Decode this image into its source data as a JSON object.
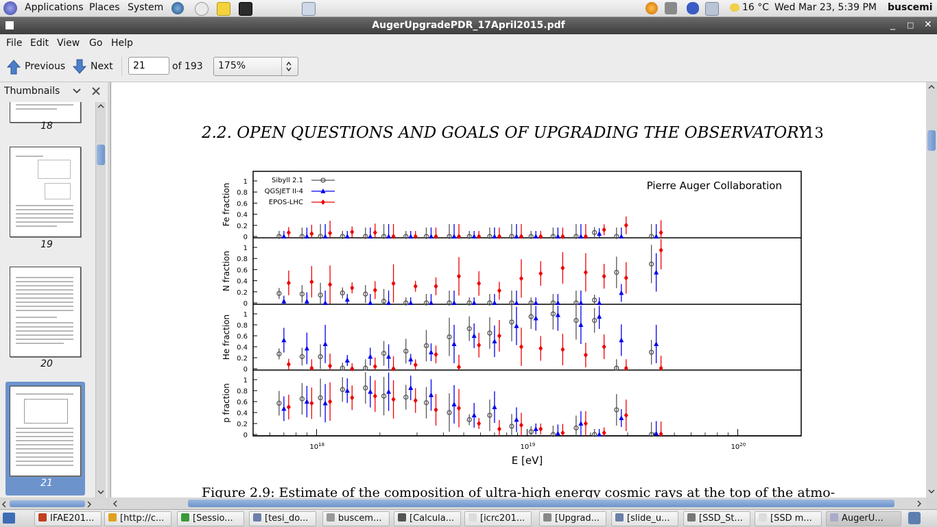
{
  "top_panel": {
    "menus": [
      "Applications",
      "Places",
      "System"
    ],
    "weather": "16 °C",
    "clock": "Wed Mar 23,  5:39 PM",
    "user": "buscemi"
  },
  "window": {
    "title": "AugerUpgradePDR_17April2015.pdf",
    "controls": {
      "minimize": "_",
      "maximize": "□",
      "close": "✕"
    }
  },
  "menubar": [
    "File",
    "Edit",
    "View",
    "Go",
    "Help"
  ],
  "toolbar": {
    "previous_label": "Previous",
    "next_label": "Next",
    "page_value": "21",
    "page_total": "of 193",
    "zoom": "175%"
  },
  "sidebar": {
    "title": "Thumbnails",
    "thumbnails": [
      {
        "label": "18"
      },
      {
        "label": "19"
      },
      {
        "label": "20"
      },
      {
        "label": "21",
        "selected": true
      }
    ]
  },
  "document": {
    "header": "2.2.  OPEN QUESTIONS AND GOALS OF UPGRADING THE OBSERVATORY",
    "page_number": "13",
    "caption": "Figure 2.9:  Estimate of the composition of ultra-high energy cosmic rays at the top of the atmo-"
  },
  "chart_data": {
    "type": "scatter",
    "annotation": "Pierre Auger Collaboration",
    "xlabel": "E [eV]",
    "xscale": "log",
    "xlim": [
      5e+17,
      2e+20
    ],
    "xticks": [
      "10^18",
      "10^19",
      "10^20"
    ],
    "legend": [
      "Sibyll 2.1",
      "QGSJET II-4",
      "EPOS-LHC"
    ],
    "legend_position": "top-left",
    "colors": {
      "Sibyll 2.1": "#555555",
      "QGSJET II-4": "#0000ee",
      "EPOS-LHC": "#ee0000"
    },
    "panels": [
      {
        "ylabel": "Fe fraction",
        "ylim": [
          0,
          1
        ],
        "yticks": [
          "0",
          "0.2",
          "0.4",
          "0.6",
          "0.8",
          "1"
        ],
        "x": [
          7e+17,
          9e+17,
          1.1e+18,
          1.4e+18,
          1.8e+18,
          2.2e+18,
          2.8e+18,
          3.5e+18,
          4.5e+18,
          5.6e+18,
          7e+18,
          8.9e+18,
          1.1e+19,
          1.4e+19,
          1.8e+19,
          2.2e+19,
          2.8e+19,
          4.1e+19
        ],
        "series": [
          {
            "name": "Sibyll 2.1",
            "values": [
              0,
              0,
              0,
              0,
              0,
              0,
              0,
              0,
              0,
              0,
              0,
              0,
              0,
              0,
              0,
              0.07,
              0,
              0
            ]
          },
          {
            "name": "QGSJET II-4",
            "values": [
              0,
              0,
              0,
              0,
              0,
              0,
              0,
              0,
              0,
              0,
              0,
              0,
              0,
              0,
              0,
              0.05,
              0,
              0
            ]
          },
          {
            "name": "EPOS-LHC",
            "values": [
              0.07,
              0.05,
              0.06,
              0.08,
              0.07,
              0,
              0,
              0,
              0,
              0,
              0,
              0,
              0,
              0,
              0,
              0.12,
              0.2,
              0.07
            ]
          }
        ]
      },
      {
        "ylabel": "N fraction",
        "ylim": [
          0,
          1
        ],
        "yticks": [
          "0",
          "0.2",
          "0.4",
          "0.6",
          "0.8",
          "1"
        ],
        "x": [
          7e+17,
          9e+17,
          1.1e+18,
          1.4e+18,
          1.8e+18,
          2.2e+18,
          2.8e+18,
          3.5e+18,
          4.5e+18,
          5.6e+18,
          7e+18,
          8.9e+18,
          1.1e+19,
          1.4e+19,
          1.8e+19,
          2.2e+19,
          2.8e+19,
          4.1e+19
        ],
        "series": [
          {
            "name": "Sibyll 2.1",
            "values": [
              0.17,
              0.16,
              0.14,
              0.18,
              0.16,
              0.03,
              0,
              0,
              0,
              0,
              0,
              0,
              0,
              0,
              0,
              0.05,
              0.55,
              0.7
            ]
          },
          {
            "name": "QGSJET II-4",
            "values": [
              0.03,
              0.03,
              0,
              0.06,
              0,
              0,
              0,
              0,
              0,
              0,
              0,
              0,
              0,
              0,
              0,
              0,
              0.18,
              0.55
            ]
          },
          {
            "name": "EPOS-LHC",
            "values": [
              0.36,
              0.38,
              0.33,
              0.27,
              0.23,
              0.35,
              0.3,
              0.3,
              0.48,
              0.35,
              0.22,
              0.44,
              0.53,
              0.63,
              0.55,
              0.48,
              0.45,
              0.95
            ]
          }
        ]
      },
      {
        "ylabel": "He fraction",
        "ylim": [
          0,
          1
        ],
        "yticks": [
          "0",
          "0.2",
          "0.4",
          "0.6",
          "0.8",
          "1"
        ],
        "x": [
          7e+17,
          9e+17,
          1.1e+18,
          1.4e+18,
          1.8e+18,
          2.2e+18,
          2.8e+18,
          3.5e+18,
          4.5e+18,
          5.6e+18,
          7e+18,
          8.9e+18,
          1.1e+19,
          1.4e+19,
          1.8e+19,
          2.2e+19,
          2.8e+19,
          4.1e+19
        ],
        "series": [
          {
            "name": "Sibyll 2.1",
            "values": [
              0.27,
              0.22,
              0.22,
              0.01,
              0.01,
              0.28,
              0.32,
              0.42,
              0.58,
              0.73,
              0.65,
              0.85,
              0.95,
              1.0,
              0.88,
              0.88,
              0.01,
              0.3
            ]
          },
          {
            "name": "QGSJET II-4",
            "values": [
              0.52,
              0.37,
              0.45,
              0.15,
              0.22,
              0.22,
              0.17,
              0.3,
              0.45,
              0.6,
              0.5,
              0.78,
              0.92,
              0.98,
              0.8,
              0.95,
              0.52,
              0.45
            ]
          },
          {
            "name": "EPOS-LHC",
            "values": [
              0.08,
              0.01,
              0.05,
              0,
              0.04,
              0,
              0.07,
              0.26,
              0.03,
              0.43,
              0.6,
              0.4,
              0.37,
              0.35,
              0.25,
              0.4,
              0.01,
              0.01
            ]
          }
        ]
      },
      {
        "ylabel": "p fraction",
        "ylim": [
          0,
          1
        ],
        "yticks": [
          "0",
          "0.2",
          "0.4",
          "0.6",
          "0.8",
          "1"
        ],
        "x": [
          7e+17,
          9e+17,
          1.1e+18,
          1.4e+18,
          1.8e+18,
          2.2e+18,
          2.8e+18,
          3.5e+18,
          4.5e+18,
          5.6e+18,
          7e+18,
          8.9e+18,
          1.1e+19,
          1.4e+19,
          1.8e+19,
          2.2e+19,
          2.8e+19,
          4.1e+19
        ],
        "series": [
          {
            "name": "Sibyll 2.1",
            "values": [
              0.57,
              0.65,
              0.67,
              0.82,
              0.85,
              0.7,
              0.68,
              0.58,
              0.4,
              0.27,
              0.35,
              0.15,
              0.05,
              0,
              0.12,
              0,
              0.45,
              0
            ]
          },
          {
            "name": "QGSJET II-4",
            "values": [
              0.47,
              0.6,
              0.57,
              0.8,
              0.78,
              0.78,
              0.85,
              0.72,
              0.55,
              0.35,
              0.5,
              0.27,
              0.1,
              0.02,
              0.2,
              0,
              0.3,
              0.02
            ]
          },
          {
            "name": "EPOS-LHC",
            "values": [
              0.5,
              0.57,
              0.6,
              0.67,
              0.7,
              0.64,
              0.62,
              0.45,
              0.48,
              0.2,
              0.1,
              0.17,
              0.1,
              0.03,
              0.2,
              0.03,
              0.35,
              0.01
            ]
          }
        ]
      }
    ]
  },
  "taskbar": [
    "IFAE201...",
    "[http://c...",
    "[Sessio...",
    "[tesi_do...",
    "buscem...",
    "[Calcula...",
    "[icrc201...",
    "[Upgrad...",
    "[slide_u...",
    "[SSD_St...",
    "[SSD m...",
    "AugerU..."
  ]
}
